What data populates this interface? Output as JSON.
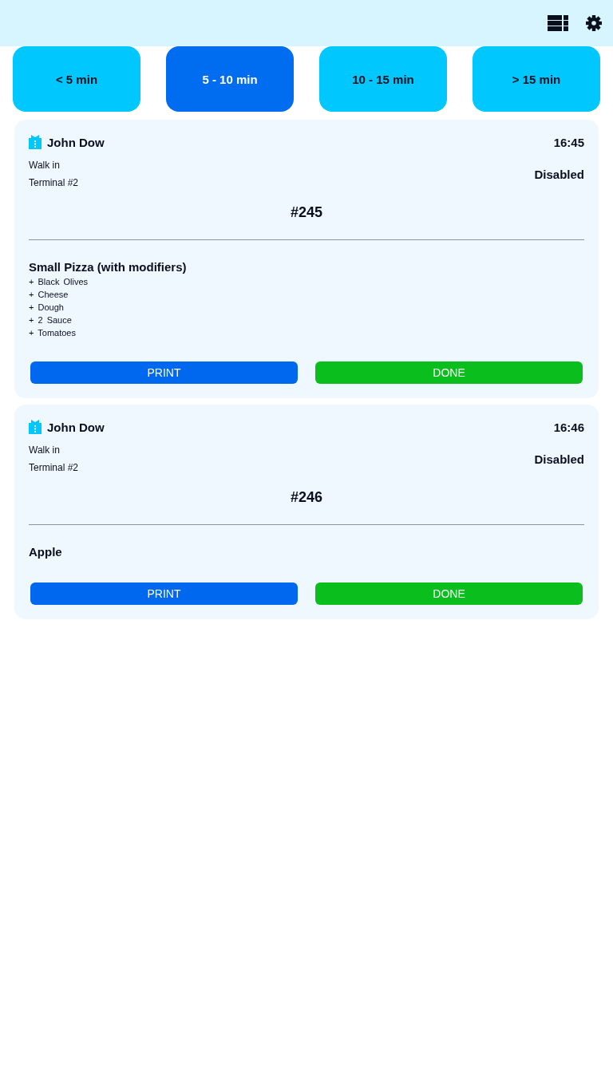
{
  "tabs": [
    {
      "label": "< 5 min",
      "selected": false
    },
    {
      "label": "5 - 10 min",
      "selected": true
    },
    {
      "label": "10 - 15 min",
      "selected": false
    },
    {
      "label": "> 15 min",
      "selected": false
    }
  ],
  "orders": [
    {
      "customer": "John Dow",
      "time": "16:45",
      "order_type": "Walk in",
      "terminal": "Terminal #2",
      "status": "Disabled",
      "number": "#245",
      "items": [
        {
          "name": "Small Pizza (with modifiers)",
          "modifiers": [
            "+ Black Olives",
            "+ Cheese",
            "+ Dough",
            "+ 2 Sauce",
            "+ Tomatoes"
          ]
        }
      ],
      "buttons": [
        {
          "kind": "print",
          "label": "PRINT"
        },
        {
          "kind": "done",
          "label": "DONE"
        }
      ]
    },
    {
      "customer": "John Dow",
      "time": "16:46",
      "order_type": "Walk in",
      "terminal": "Terminal #2",
      "status": "Disabled",
      "number": "#246",
      "items": [
        {
          "name": "Apple"
        }
      ],
      "buttons": [
        {
          "kind": "print",
          "label": "PRINT"
        },
        {
          "kind": "done",
          "label": "DONE"
        }
      ]
    }
  ]
}
